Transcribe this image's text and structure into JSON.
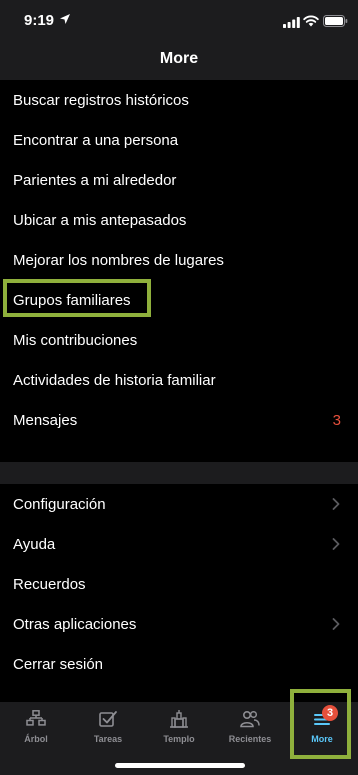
{
  "status_bar": {
    "time": "9:19"
  },
  "header": {
    "title": "More"
  },
  "menu_section_1": [
    {
      "label": "Buscar registros históricos"
    },
    {
      "label": "Encontrar a una persona"
    },
    {
      "label": "Parientes a mi alrededor"
    },
    {
      "label": "Ubicar a mis antepasados"
    },
    {
      "label": "Mejorar los nombres de lugares"
    },
    {
      "label": "Grupos familiares"
    },
    {
      "label": "Mis contribuciones"
    },
    {
      "label": "Actividades de historia familiar"
    },
    {
      "label": "Mensajes",
      "count": "3"
    }
  ],
  "menu_section_2": [
    {
      "label": "Configuración"
    },
    {
      "label": "Ayuda"
    },
    {
      "label": "Recuerdos"
    },
    {
      "label": "Otras aplicaciones"
    },
    {
      "label": "Cerrar sesión"
    }
  ],
  "tabbar": {
    "tabs": [
      {
        "label": "Árbol",
        "icon": "tree-icon"
      },
      {
        "label": "Tareas",
        "icon": "tasks-icon"
      },
      {
        "label": "Templo",
        "icon": "temple-icon"
      },
      {
        "label": "Recientes",
        "icon": "people-icon"
      },
      {
        "label": "More",
        "icon": "menu-icon",
        "badge": "3",
        "active": true
      }
    ]
  },
  "colors": {
    "highlight": "#8fb03c",
    "badge": "#e6503c",
    "active_tab": "#5ac8fa",
    "background": "#000000",
    "bar_background": "#1c1c1e"
  }
}
